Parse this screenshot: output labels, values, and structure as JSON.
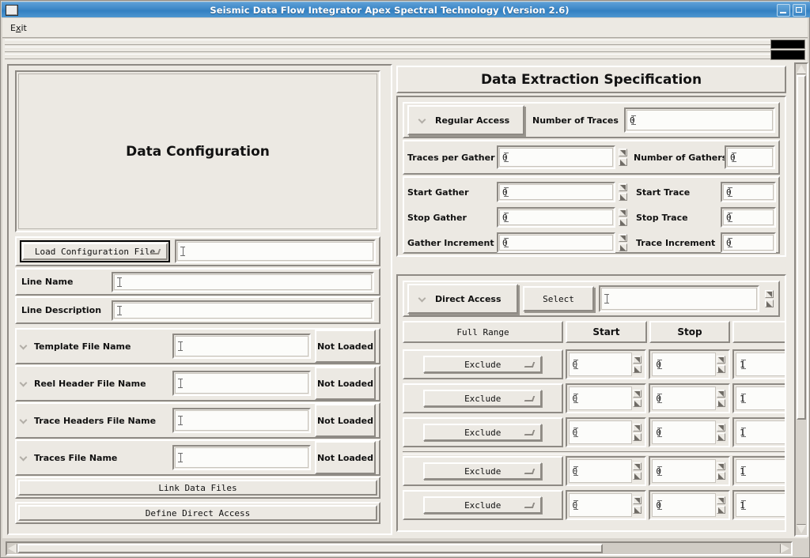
{
  "window": {
    "title": "Seismic Data Flow Integrator Apex Spectral Technology (Version 2.6)",
    "icon": "window-menu-icon",
    "minimize_label": "minimize-icon",
    "maximize_label": "maximize-icon"
  },
  "menubar": {
    "items": [
      {
        "label": "Exit",
        "mnemonic": "x",
        "pre": "E",
        "post": "it"
      }
    ]
  },
  "left_panel": {
    "config_title": "Data Configuration",
    "load_button": {
      "label": "Load Configuration File",
      "indicator": "dropdown-indicator"
    },
    "load_field_value": "",
    "fields": [
      {
        "label": "Line Name",
        "value": ""
      },
      {
        "label": "Line Description",
        "value": ""
      }
    ],
    "file_rows": [
      {
        "label": "Template File Name",
        "value": "",
        "status": "Not Loaded",
        "icon": "chevron-down-icon"
      },
      {
        "label": "Reel Header File Name",
        "value": "",
        "status": "Not Loaded",
        "icon": "chevron-down-icon"
      },
      {
        "label": "Trace Headers File Name",
        "value": "",
        "status": "Not Loaded",
        "icon": "chevron-down-icon"
      },
      {
        "label": "Traces File Name",
        "value": "",
        "status": "Not Loaded",
        "icon": "chevron-down-icon"
      }
    ],
    "actions": [
      {
        "label": "Link Data Files"
      },
      {
        "label": "Define Direct Access"
      }
    ]
  },
  "right_panel": {
    "title": "Data Extraction Specification",
    "regular_access": {
      "toggle_label": "Regular Access",
      "toggle_icon": "chevron-down-icon",
      "number_of_traces": {
        "label": "Number of Traces",
        "value": "0"
      },
      "traces_per_gather": {
        "label": "Traces per Gather",
        "value": "0"
      },
      "number_of_gathers": {
        "label": "Number of Gathers",
        "value": "0"
      },
      "start_gather": {
        "label": "Start Gather",
        "value": "0"
      },
      "stop_gather": {
        "label": "Stop Gather",
        "value": "0"
      },
      "gather_increment": {
        "label": "Gather Increment",
        "value": "0"
      },
      "start_trace": {
        "label": "Start Trace",
        "value": "0"
      },
      "stop_trace": {
        "label": "Stop Trace",
        "value": "0"
      },
      "trace_increment": {
        "label": "Trace Increment",
        "value": "0"
      }
    },
    "direct_access": {
      "toggle_label": "Direct Access",
      "toggle_icon": "chevron-down-icon",
      "select_button": "Select",
      "select_field_value": "",
      "headers": [
        "Full Range",
        "Start",
        "Stop",
        ""
      ],
      "rows": [
        {
          "mode": "Exclude",
          "start": "0",
          "stop": "0",
          "increment": "1"
        },
        {
          "mode": "Exclude",
          "start": "0",
          "stop": "0",
          "increment": "1"
        },
        {
          "mode": "Exclude",
          "start": "0",
          "stop": "0",
          "increment": "1"
        },
        {
          "mode": "Exclude",
          "start": "0",
          "stop": "0",
          "increment": "1"
        },
        {
          "mode": "Exclude",
          "start": "0",
          "stop": "0",
          "increment": "1"
        }
      ]
    }
  },
  "scrollbars": {
    "vertical": {
      "up_icon": "scroll-up-arrow-icon",
      "down_icon": "scroll-down-arrow-icon"
    },
    "horizontal": {
      "left_icon": "scroll-left-arrow-icon",
      "right_icon": "scroll-right-arrow-icon"
    }
  },
  "colors": {
    "titlebar": "#3d87c6",
    "face": "#ece9e3",
    "shadow": "#8e8a84",
    "light": "#ffffff",
    "field": "#fcfcfa"
  }
}
